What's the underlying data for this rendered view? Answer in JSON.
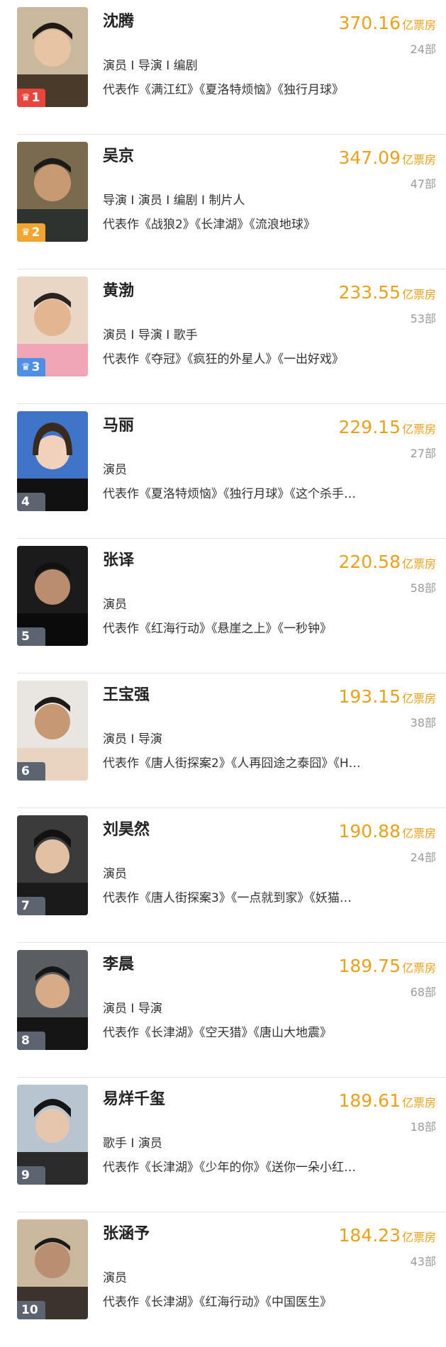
{
  "colors": {
    "accent": "#e9a11b",
    "rank1": "#e8453c",
    "rank2": "#f2a531",
    "rank3": "#4f8fe6",
    "rank_default": "#5b6470"
  },
  "items": [
    {
      "rank": "1",
      "name": "沈腾",
      "box": "370.16",
      "unit": "亿票房",
      "count": "24部",
      "roles": "演员 I 导演 I 编剧",
      "works": "代表作《满江红》《夏洛特烦恼》《独行月球》"
    },
    {
      "rank": "2",
      "name": "吴京",
      "box": "347.09",
      "unit": "亿票房",
      "count": "47部",
      "roles": "导演 I 演员 I 编剧 I 制片人",
      "works": "代表作《战狼2》《长津湖》《流浪地球》"
    },
    {
      "rank": "3",
      "name": "黄渤",
      "box": "233.55",
      "unit": "亿票房",
      "count": "53部",
      "roles": "演员 I 导演 I 歌手",
      "works": "代表作《夺冠》《疯狂的外星人》《一出好戏》"
    },
    {
      "rank": "4",
      "name": "马丽",
      "box": "229.15",
      "unit": "亿票房",
      "count": "27部",
      "roles": "演员",
      "works": "代表作《夏洛特烦恼》《独行月球》《这个杀手…"
    },
    {
      "rank": "5",
      "name": "张译",
      "box": "220.58",
      "unit": "亿票房",
      "count": "58部",
      "roles": "演员",
      "works": "代表作《红海行动》《悬崖之上》《一秒钟》"
    },
    {
      "rank": "6",
      "name": "王宝强",
      "box": "193.15",
      "unit": "亿票房",
      "count": "38部",
      "roles": "演员 I 导演",
      "works": "代表作《唐人街探案2》《人再囧途之泰囧》《H…"
    },
    {
      "rank": "7",
      "name": "刘昊然",
      "box": "190.88",
      "unit": "亿票房",
      "count": "24部",
      "roles": "演员",
      "works": "代表作《唐人街探案3》《一点就到家》《妖猫…"
    },
    {
      "rank": "8",
      "name": "李晨",
      "box": "189.75",
      "unit": "亿票房",
      "count": "68部",
      "roles": "演员 I 导演",
      "works": "代表作《长津湖》《空天猎》《唐山大地震》"
    },
    {
      "rank": "9",
      "name": "易烊千玺",
      "box": "189.61",
      "unit": "亿票房",
      "count": "18部",
      "roles": "歌手 I 演员",
      "works": "代表作《长津湖》《少年的你》《送你一朵小红…"
    },
    {
      "rank": "10",
      "name": "张涵予",
      "box": "184.23",
      "unit": "亿票房",
      "count": "43部",
      "roles": "演员",
      "works": "代表作《长津湖》《红海行动》《中国医生》"
    }
  ]
}
